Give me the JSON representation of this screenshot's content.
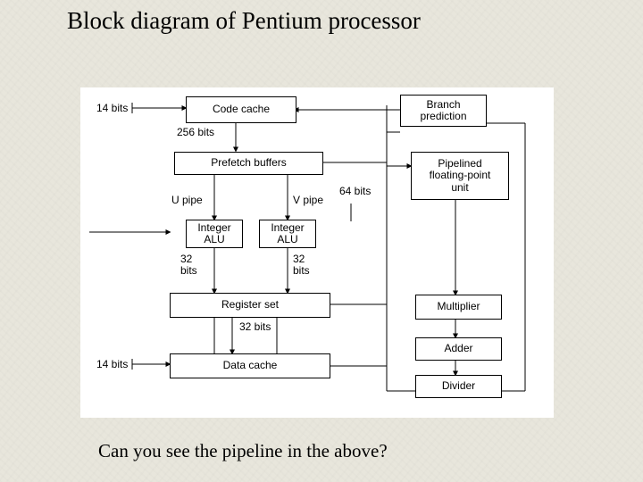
{
  "title": "Block diagram of Pentium processor",
  "caption": "Can you see the pipeline in the above?",
  "blocks": {
    "code_cache": "Code cache",
    "branch_prediction": "Branch\nprediction",
    "prefetch_buffers": "Prefetch buffers",
    "fpu": "Pipelined\nfloating-point\nunit",
    "int_alu_u": "Integer\nALU",
    "int_alu_v": "Integer\nALU",
    "register_set": "Register set",
    "multiplier": "Multiplier",
    "adder": "Adder",
    "divider": "Divider",
    "data_cache": "Data cache"
  },
  "labels": {
    "bits14_top": "14 bits",
    "bits256": "256 bits",
    "upipe": "U pipe",
    "vpipe": "V pipe",
    "bits64": "64 bits",
    "bits32_left": "32\nbits",
    "bits32_right": "32\nbits",
    "bits32_bottom": "32 bits",
    "bits14_bottom": "14 bits"
  }
}
